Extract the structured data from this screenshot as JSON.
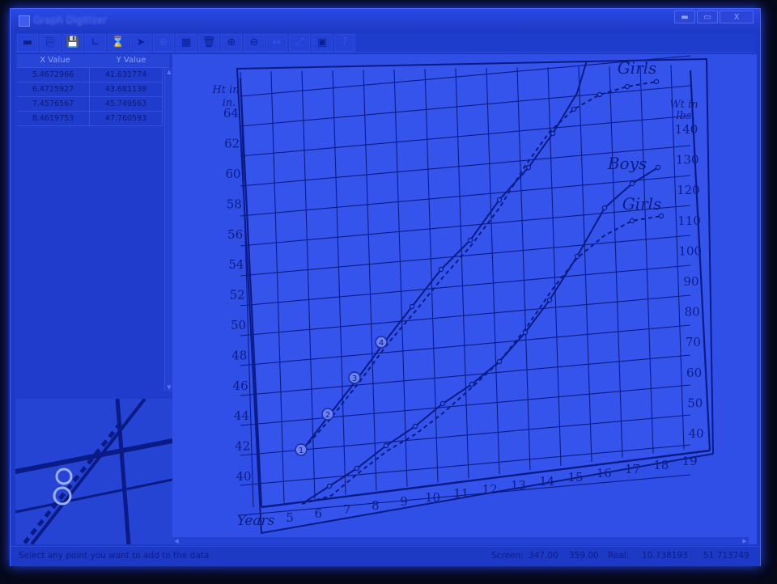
{
  "window": {
    "title": "Graph Digitizer",
    "buttons": {
      "minimize": "▬",
      "maximize": "▭",
      "close": "X"
    }
  },
  "toolbar": {
    "icons": [
      "new-file-icon",
      "open-file-icon",
      "save-icon",
      "axis-icon",
      "calibrate-icon",
      "pointer-icon",
      "move-icon",
      "table-icon",
      "delete-icon",
      "zoom-in-icon",
      "zoom-out-icon",
      "fit-icon",
      "expand-icon",
      "select-area-icon",
      "help-icon"
    ],
    "glyphs": [
      "▬",
      "⎘",
      "💾",
      "∟",
      "⌛",
      "➤",
      "⊕",
      "▦",
      "🗑",
      "⊕",
      "⊖",
      "⇔",
      "⤢",
      "▣",
      "?"
    ]
  },
  "table": {
    "headers": [
      "X Value",
      "Y Value"
    ],
    "rows": [
      [
        "5.4672966",
        "41.631774"
      ],
      [
        "6.4725927",
        "43.681138"
      ],
      [
        "7.4576567",
        "45.749563"
      ],
      [
        "8.4619753",
        "47.760593"
      ]
    ]
  },
  "graph": {
    "left_axis_units": [
      "Ht in",
      "in."
    ],
    "right_axis_units": [
      "Wt in",
      "lbs."
    ],
    "left_ticks": [
      "40",
      "42",
      "44",
      "46",
      "48",
      "50",
      "52",
      "54",
      "56",
      "58",
      "60",
      "62",
      "64"
    ],
    "right_ticks": [
      "40",
      "50",
      "60",
      "70",
      "80",
      "90",
      "100",
      "110",
      "120",
      "130",
      "140"
    ],
    "bottom_prefix": "Years",
    "bottom_ticks": [
      "5",
      "6",
      "7",
      "8",
      "9",
      "10",
      "11",
      "12",
      "13",
      "14",
      "15",
      "16",
      "17",
      "18",
      "19"
    ],
    "labels": {
      "girls_top": "Girls",
      "boys": "Boys",
      "girls_bottom": "Girls"
    },
    "markers": [
      "1",
      "2",
      "3",
      "4"
    ]
  },
  "status": {
    "message": "Select any point you want to add to the data",
    "screen_label": "Screen:",
    "screen_x": "347.00",
    "screen_y": "359.00",
    "real_label": "Real:",
    "real_x": "10.738193",
    "real_y": "51.713749"
  }
}
